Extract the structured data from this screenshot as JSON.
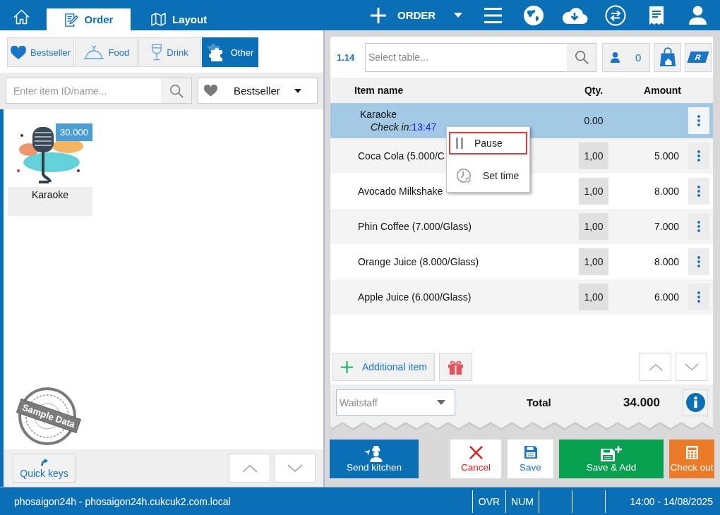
{
  "tabs": [
    {
      "kind": "order",
      "label": "Order",
      "selected": true
    },
    {
      "kind": "layout",
      "label": "Layout",
      "selected": false
    }
  ],
  "new_order_button": "ORDER",
  "categories": [
    {
      "kind": "bestseller",
      "label": "Bestseller",
      "selected": false
    },
    {
      "kind": "food",
      "label": "Food",
      "selected": false
    },
    {
      "kind": "drink",
      "label": "Drink",
      "selected": false
    },
    {
      "kind": "other",
      "label": "Other",
      "selected": true
    }
  ],
  "item_search": {
    "placeholder": "Enter item ID/name..."
  },
  "item_filter": {
    "value": "Bestseller"
  },
  "menu_items": [
    {
      "name": "Karaoke",
      "price": "30.000"
    }
  ],
  "sample_stamp": "Sample Data",
  "quick_keys_button": "Quick keys",
  "order": {
    "table_number": "1.14",
    "table_search": {
      "placeholder": "Select table..."
    },
    "guest_count": "0",
    "reservation_tag": "R",
    "columns": [
      "Item name",
      "Qty.",
      "Amount"
    ],
    "rows": [
      {
        "kind": "timed",
        "name": "Karaoke",
        "check_in_label": "Check in:",
        "check_in_time": "13:47",
        "qty": "0.00",
        "selected": true
      },
      {
        "kind": "item",
        "name": "Coca Cola (5.000/C",
        "qty": "1,00",
        "amount": "5.000",
        "selected": false
      },
      {
        "kind": "item",
        "name": "Avocado Milkshake",
        "qty": "1,00",
        "amount": "8.000",
        "selected": false
      },
      {
        "kind": "item",
        "name": "Phin Coffee (7.000/Glass)",
        "qty": "1,00",
        "amount": "7.000",
        "selected": false
      },
      {
        "kind": "item",
        "name": "Orange Juice (8.000/Glass)",
        "qty": "1,00",
        "amount": "8.000",
        "selected": false
      },
      {
        "kind": "item",
        "name": "Apple Juice (6.000/Glass)",
        "qty": "1,00",
        "amount": "6.000",
        "selected": false
      }
    ],
    "context_menu": [
      {
        "kind": "pause",
        "label": "Pause",
        "selected": true
      },
      {
        "kind": "set_time",
        "label": "Set time",
        "selected": false
      }
    ],
    "additional_item_button": "Additional item",
    "waitstaff": {
      "placeholder": "Waitstaff"
    },
    "total_label": "Total",
    "total_value": "34.000"
  },
  "actions": [
    {
      "kind": "send_kitchen",
      "label": "Send kitchen"
    },
    {
      "kind": "cancel",
      "label": "Cancel"
    },
    {
      "kind": "save",
      "label": "Save"
    },
    {
      "kind": "save_add",
      "label": "Save & Add"
    },
    {
      "kind": "checkout",
      "label": "Check out"
    }
  ],
  "status_bar": {
    "connection": "phosaigon24h - phosaigon24h.cukcuk2.com.local",
    "indicators": [
      "OVR",
      "NUM"
    ],
    "datetime": "14:00 - 14/08/2025"
  }
}
